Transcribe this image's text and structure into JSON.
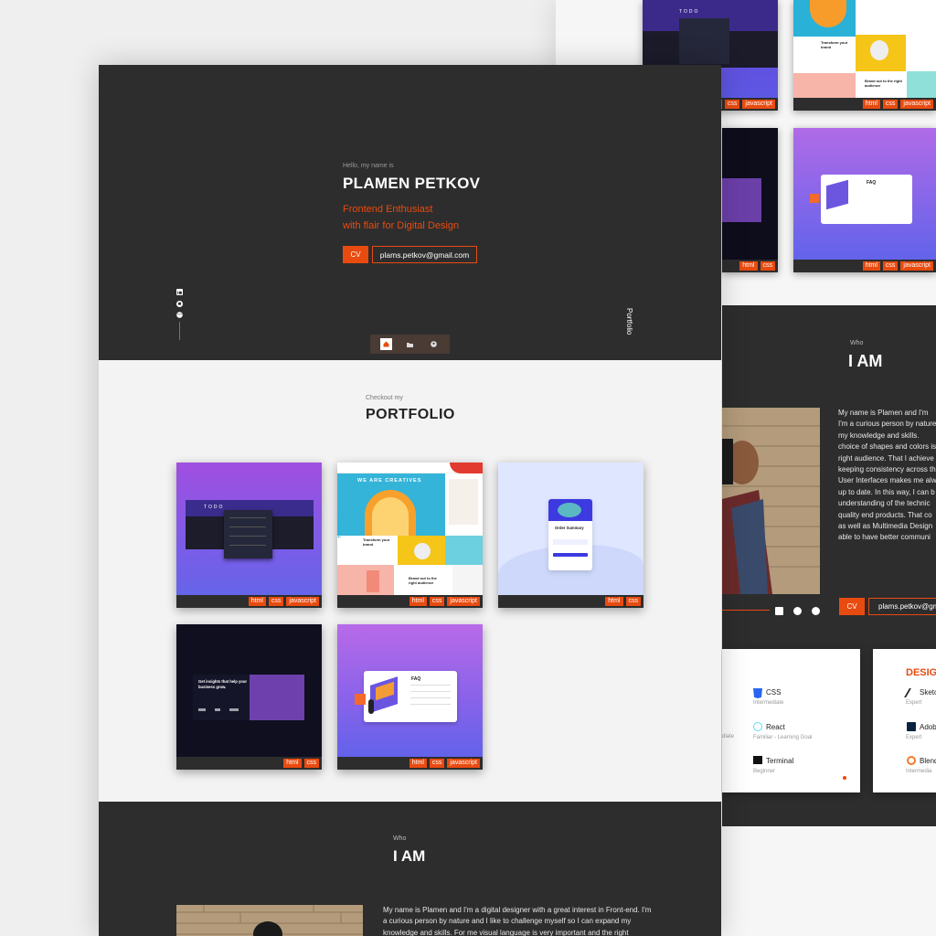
{
  "hero": {
    "greeting": "Hello, my name is",
    "name": "PLAMEN PETKOV",
    "tagline_1": "Frontend Enthusiast",
    "tagline_2": "with flair for Digital Design",
    "cv_label": "CV",
    "email": "plams.petkov@gmail.com",
    "side_label": "Portfolio",
    "social_icons": [
      "linkedin-icon",
      "github-icon",
      "dribbble-icon"
    ],
    "nav_icons": [
      "home-icon",
      "folder-icon",
      "user-icon"
    ]
  },
  "portfolio": {
    "kicker": "Checkout my",
    "title": "PORTFOLIO",
    "items": [
      {
        "preview_text": "TODO",
        "tags": [
          "html",
          "css",
          "javascript"
        ]
      },
      {
        "preview_text": "WE ARE CREATIVES",
        "sub_1": "Transform your brand",
        "sub_2": "Brand out to the right audience",
        "tags": [
          "html",
          "css",
          "javascript"
        ]
      },
      {
        "preview_text": "Order Summary",
        "tags": [
          "html",
          "css"
        ]
      },
      {
        "preview_text": "Get insights that help your business grow.",
        "tags": [
          "html",
          "css"
        ]
      },
      {
        "preview_text": "FAQ",
        "tags": [
          "html",
          "css",
          "javascript"
        ]
      }
    ]
  },
  "about": {
    "kicker": "Who",
    "title": "I AM",
    "paragraph": "My name is Plamen and I'm a digital designer with a great interest in Front-end. I'm a curious person by nature and I like to challenge myself so I can expand my knowledge and skills. For me visual language is very important and the right",
    "paragraph_lines_back": [
      "My name is Plamen and I'm",
      "I'm a curious person by nature",
      "my knowledge and skills.",
      "choice of shapes and colors is",
      "right audience. That I achieve",
      "keeping consistency across th",
      "User Interfaces makes me alw",
      "up to date. In this way, I can b",
      "understanding of the technic",
      "quality end products. That co",
      "as well as Multimedia Design",
      "able to have better communi"
    ],
    "cv_label": "CV",
    "email": "plams.petkov@gm"
  },
  "skills": {
    "dev": [
      {
        "name": "CSS",
        "level": "Intermediate"
      },
      {
        "name": "React",
        "level": "Familiar - Learning Goal"
      },
      {
        "name": "Terminal",
        "level": "Beginner"
      }
    ],
    "partial_level": "diate",
    "design_title": "DESIG",
    "design": [
      {
        "name": "Sketc",
        "level": "Expert"
      },
      {
        "name": "Adob",
        "level": "Expert"
      },
      {
        "name": "Blend",
        "level": "Intermedia"
      }
    ]
  },
  "back_thumbs": {
    "t1_tags": [
      "html",
      "css",
      "javascript"
    ],
    "t2_tags": [
      "html",
      "css",
      "javascript"
    ],
    "t3_tags": [
      "html",
      "css"
    ],
    "t4_tags": [
      "html",
      "css",
      "javascript"
    ],
    "t2_sub_1": "Transform your brand",
    "t2_sub_2": "Brand out to the right audience",
    "t4_text": "FAQ",
    "t1_text": "TODO"
  },
  "colors": {
    "accent": "#e84b10",
    "dark": "#2d2d2d",
    "light": "#f3f3f3"
  }
}
